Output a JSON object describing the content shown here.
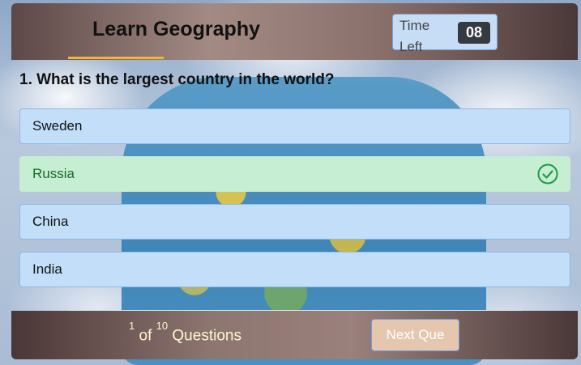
{
  "header": {
    "title": "Learn Geography",
    "timer_label": "Time Left",
    "timer_seconds": "08"
  },
  "question": {
    "number": "1.",
    "text": "What is the largest country in the world?",
    "full": "1. What is the largest country in the world?"
  },
  "options": [
    {
      "label": "Sweden",
      "state": "default"
    },
    {
      "label": "Russia",
      "state": "correct"
    },
    {
      "label": "China",
      "state": "default"
    },
    {
      "label": "India",
      "state": "default"
    }
  ],
  "footer": {
    "current": "1",
    "of_text": "of",
    "total": "10",
    "questions_text": "Questions",
    "next_label": "Next Que"
  },
  "colors": {
    "accent": "#f3b43a",
    "option_bg": "#c3def8",
    "correct_bg": "#c5eed2",
    "correct_text": "#196b2a"
  },
  "icons": {
    "correct": "check-circle-icon"
  }
}
